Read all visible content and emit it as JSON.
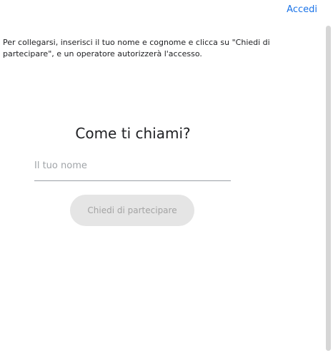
{
  "header": {
    "login_link": "Accedi"
  },
  "instructions": "Per collegarsi, inserisci il tuo nome e cognome e clicca su \"Chiedi di partecipare\", e un operatore autorizzerà l'accesso.",
  "join": {
    "title": "Come ti chiami?",
    "name_field": {
      "placeholder": "Il tuo nome",
      "value": ""
    },
    "button_label": "Chiedi di partecipare"
  },
  "colors": {
    "link": "#1a73e8",
    "button_disabled_bg": "#e5e5e5",
    "button_disabled_text": "#a3a3a3"
  }
}
